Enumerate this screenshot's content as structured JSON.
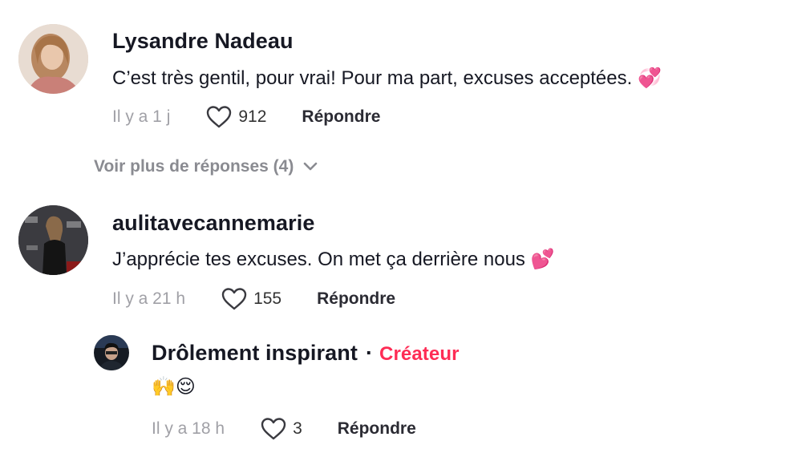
{
  "comments": [
    {
      "username": "Lysandre Nadeau",
      "text": "C’est très gentil, pour vrai! Pour ma part, excuses acceptées. 💞",
      "time": "Il y a 1 j",
      "likes": "912",
      "reply_label": "Répondre",
      "avatar_icon": "user-avatar-photo"
    },
    {
      "username": "aulitavecannemarie",
      "text": "J’apprécie tes excuses. On met ça derrière nous 💕",
      "time": "Il y a 21 h",
      "likes": "155",
      "reply_label": "Répondre",
      "avatar_icon": "user-avatar-photo"
    }
  ],
  "more_replies": {
    "label": "Voir plus de réponses (4)",
    "icon": "chevron-down-icon"
  },
  "reply": {
    "username": "Drôlement inspirant",
    "separator": "·",
    "badge": "Créateur",
    "text": "🙌😌",
    "time": "Il y a 18 h",
    "likes": "3",
    "reply_label": "Répondre"
  },
  "colors": {
    "creator_badge": "#fe2c55",
    "muted_text": "#a0a0a6",
    "primary_text": "#161823"
  }
}
